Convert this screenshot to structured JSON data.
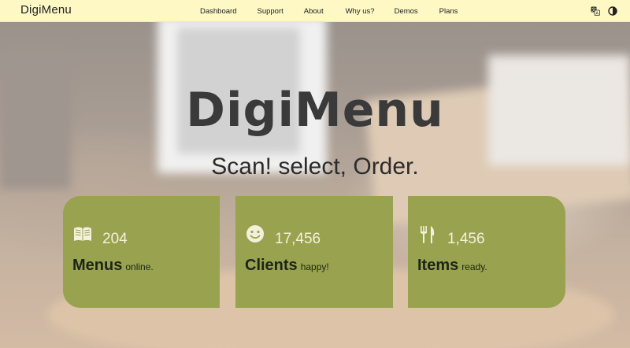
{
  "navbar": {
    "brand": "DigiMenu",
    "links": [
      "Dashboard",
      "Support",
      "About",
      "Why us?",
      "Demos",
      "Plans"
    ],
    "tools": [
      "translate-icon",
      "theme-toggle-icon"
    ]
  },
  "hero": {
    "title": "DigiMenu",
    "subtitle": "Scan! select, Order."
  },
  "stats": [
    {
      "icon": "book-icon",
      "number": "204",
      "label": "Menus",
      "suffix": "online."
    },
    {
      "icon": "smiley-icon",
      "number": "17,456",
      "label": "Clients",
      "suffix": "happy!"
    },
    {
      "icon": "utensils-icon",
      "number": "1,456",
      "label": "Items",
      "suffix": "ready."
    }
  ],
  "colors": {
    "navbar_bg": "#fdf8c4",
    "card_bg": "#99a24f",
    "number_text": "#f3f1dc"
  }
}
